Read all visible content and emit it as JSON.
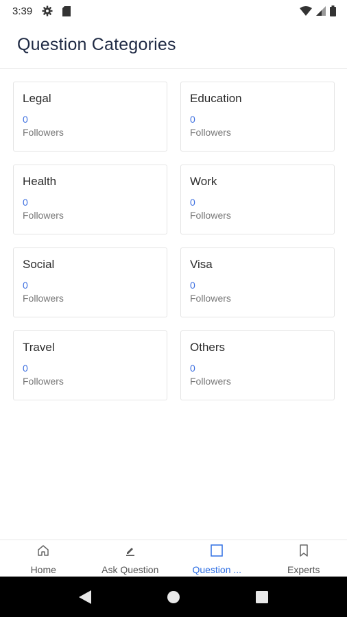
{
  "status_bar": {
    "time": "3:39",
    "icons": [
      "gear-icon",
      "sim-card-icon",
      "wifi-icon",
      "signal-icon",
      "battery-icon"
    ]
  },
  "header": {
    "title": "Question Categories"
  },
  "categories": [
    {
      "name": "Legal",
      "count": "0",
      "followers_label": "Followers"
    },
    {
      "name": "Education",
      "count": "0",
      "followers_label": "Followers"
    },
    {
      "name": "Health",
      "count": "0",
      "followers_label": "Followers"
    },
    {
      "name": "Work",
      "count": "0",
      "followers_label": "Followers"
    },
    {
      "name": "Social",
      "count": "0",
      "followers_label": "Followers"
    },
    {
      "name": "Visa",
      "count": "0",
      "followers_label": "Followers"
    },
    {
      "name": "Travel",
      "count": "0",
      "followers_label": "Followers"
    },
    {
      "name": "Others",
      "count": "0",
      "followers_label": "Followers"
    }
  ],
  "tabs": [
    {
      "label": "Home",
      "icon": "home-icon",
      "active": false
    },
    {
      "label": "Ask Question",
      "icon": "pencil-icon",
      "active": false
    },
    {
      "label": "Question ...",
      "icon": "square-icon",
      "active": true
    },
    {
      "label": "Experts",
      "icon": "bookmark-icon",
      "active": false
    }
  ],
  "colors": {
    "accent": "#2f6fe4",
    "count": "#3d6fe0",
    "title": "#1f2a44"
  },
  "nav_bar": {
    "buttons": [
      "back-icon",
      "home-circle-icon",
      "recents-icon"
    ]
  }
}
